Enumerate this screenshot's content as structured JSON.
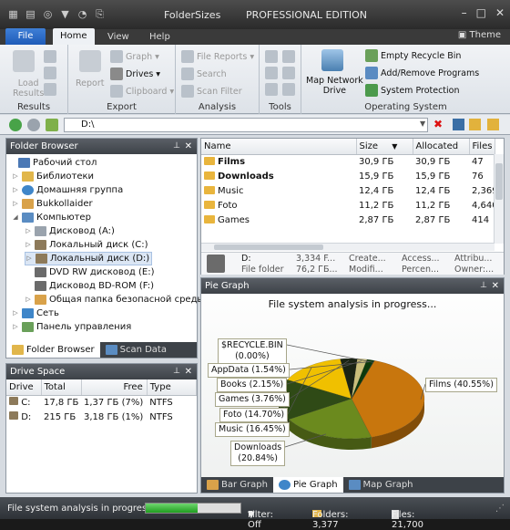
{
  "window": {
    "title": "FolderSizes",
    "edition": "PROFESSIONAL EDITION"
  },
  "ribbon": {
    "file": "File",
    "tabs": [
      {
        "label": "Home"
      },
      {
        "label": "View"
      },
      {
        "label": "Help"
      }
    ],
    "theme": "Theme",
    "groups": {
      "results": {
        "label": "Results",
        "load": "Load",
        "results": "Results"
      },
      "export": {
        "label": "Export",
        "report": "Report",
        "graph": "Graph",
        "drives": "Drives",
        "clipboard": "Clipboard"
      },
      "analysis": {
        "label": "Analysis",
        "file_reports": "File Reports",
        "search": "Search",
        "scan_filter": "Scan Filter"
      },
      "tools": {
        "label": "Tools"
      },
      "os": {
        "label": "Operating System",
        "map1": "Map Network",
        "map2": "Drive",
        "empty": "Empty Recycle Bin",
        "addremove": "Add/Remove Programs",
        "sysprot": "System Protection"
      }
    }
  },
  "address": {
    "value": "D:\\"
  },
  "folder_browser": {
    "title": "Folder Browser",
    "items": [
      {
        "label": "Рабочий стол"
      },
      {
        "label": "Библиотеки"
      },
      {
        "label": "Домашняя группа"
      },
      {
        "label": "Bukkollaider"
      },
      {
        "label": "Компьютер"
      },
      {
        "label": "Дисковод (A:)"
      },
      {
        "label": "Локальный диск (C:)"
      },
      {
        "label": "Локальный диск (D:)"
      },
      {
        "label": "DVD RW дисковод (E:)"
      },
      {
        "label": "Дисковод BD-ROM (F:)"
      },
      {
        "label": "Общая папка безопасной среды"
      },
      {
        "label": "Сеть"
      },
      {
        "label": "Панель управления"
      }
    ],
    "tabs": [
      "Folder Browser",
      "Scan Data"
    ]
  },
  "drive_space": {
    "title": "Drive Space",
    "columns": [
      "Drive",
      "Total",
      "Free",
      "Type"
    ],
    "rows": [
      {
        "drive": "C:",
        "total": "17,8 ГБ",
        "free": "1,37 ГБ (7%)",
        "type": "NTFS"
      },
      {
        "drive": "D:",
        "total": "215 ГБ",
        "free": "3,18 ГБ (1%)",
        "type": "NTFS"
      }
    ]
  },
  "file_list": {
    "columns": [
      "Name",
      "Size",
      "Allocated",
      "Files"
    ],
    "rows": [
      {
        "name": "Films",
        "size": "30,9 ГБ",
        "alloc": "30,9 ГБ",
        "files": "47"
      },
      {
        "name": "Downloads",
        "size": "15,9 ГБ",
        "alloc": "15,9 ГБ",
        "files": "76"
      },
      {
        "name": "Music",
        "size": "12,4 ГБ",
        "alloc": "12,4 ГБ",
        "files": "2,369"
      },
      {
        "name": "Foto",
        "size": "11,2 ГБ",
        "alloc": "11,2 ГБ",
        "files": "4,640"
      },
      {
        "name": "Games",
        "size": "2,87 ГБ",
        "alloc": "2,87 ГБ",
        "files": "414"
      }
    ],
    "summary": {
      "drive": "D:",
      "type": "File folder",
      "v1": "3,334 F...",
      "v2": "76,2 ГБ...",
      "c1": "Create...",
      "c2": "Modifi...",
      "a1": "Access...",
      "a2": "Percen...",
      "t1": "Attribu...",
      "t2": "Owner:..."
    }
  },
  "pie_graph": {
    "title": "Pie Graph",
    "heading": "File system analysis in progress...",
    "tabs": [
      "Bar Graph",
      "Pie Graph",
      "Map Graph"
    ]
  },
  "chart_data": {
    "type": "pie",
    "title": "File system analysis in progress...",
    "categories": [
      "Films",
      "Downloads",
      "Music",
      "Foto",
      "Games",
      "Books",
      "AppData",
      "$RECYCLE.BIN"
    ],
    "values": [
      40.55,
      20.84,
      16.45,
      14.7,
      3.76,
      2.15,
      1.54,
      0.0
    ],
    "labels": [
      "Films (40.55%)",
      "Downloads (20.84%)",
      "Music (16.45%)",
      "Foto (14.70%)",
      "Games (3.76%)",
      "Books (2.15%)",
      "AppData (1.54%)",
      "$RECYCLE.BIN (0.00%)"
    ],
    "colors": [
      "#c8760d",
      "#6b8a1e",
      "#2f4a16",
      "#f0c000",
      "#1a2414",
      "#c9bf7a",
      "#0b3a0b",
      "#1f3f1f"
    ]
  },
  "status": {
    "text": "File system analysis in progress...",
    "progress": 0.55,
    "filter": "Filter: Off",
    "folders": "Folders: 3,377",
    "files": "Files: 21,700"
  }
}
